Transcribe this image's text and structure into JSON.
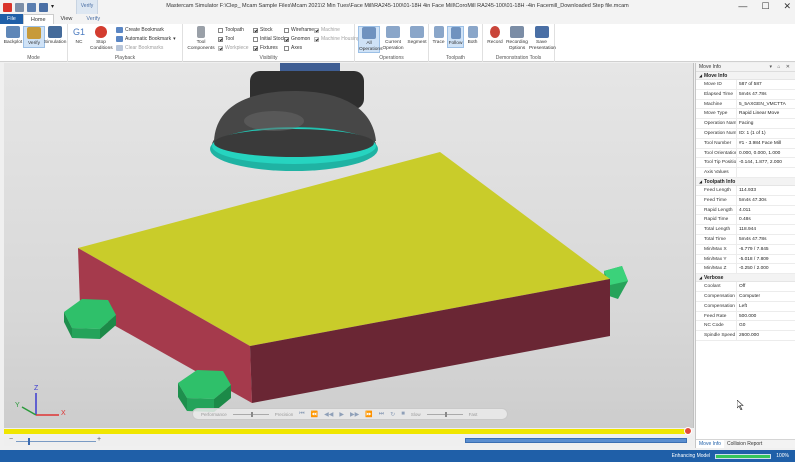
{
  "app": {
    "title": "Mastercam Simulator F:\\Clep_ Mcam Sample Files\\Mcam 2021\\2 Min Tues\\Face Mill\\RA245-100\\01-18H 4in Face Mill\\CoroMill RA245-100\\01-18H -4in Facemill_Downloaded Step file.mcam",
    "context_tab": "Verify",
    "win_min": "—",
    "win_max": "☐",
    "win_close": "✕"
  },
  "tabs": [
    {
      "label": "File"
    },
    {
      "label": "Home"
    },
    {
      "label": "View"
    },
    {
      "label": "Verify"
    }
  ],
  "ribbon": {
    "mode": {
      "label": "Mode",
      "buttons": [
        {
          "label": "Backplot"
        },
        {
          "label": "Verify"
        },
        {
          "label": "Simulation"
        }
      ]
    },
    "playback": {
      "label": "Playback",
      "nc_label": "G1",
      "nc_sub": "NC",
      "stop_label": "Stop",
      "stop_sub": "Conditions",
      "create_bookmark": "Create Bookmark",
      "automatic_bookmark": "Automatic Bookmark",
      "clear_bookmarks": "Clear Bookmarks"
    },
    "visibility": {
      "label": "Visibility",
      "tool_components": "Tool",
      "tool_components_sub": "Components",
      "items": [
        {
          "label": "Toolpath",
          "checked": false,
          "disabled": false
        },
        {
          "label": "Tool",
          "checked": true,
          "disabled": false
        },
        {
          "label": "Workpiece",
          "checked": true,
          "disabled": true
        },
        {
          "label": "Stock",
          "checked": true,
          "disabled": false
        },
        {
          "label": "Initial Stock",
          "checked": false,
          "disabled": false
        },
        {
          "label": "Fixtures",
          "checked": true,
          "disabled": false
        },
        {
          "label": "Wireframe",
          "checked": false,
          "disabled": false
        },
        {
          "label": "Gnomon",
          "checked": true,
          "disabled": false
        },
        {
          "label": "Axes",
          "checked": false,
          "disabled": false
        },
        {
          "label": "Machine",
          "checked": true,
          "disabled": true
        },
        {
          "label": "Machine Housing",
          "checked": true,
          "disabled": true
        }
      ]
    },
    "operations": {
      "label": "Operations",
      "buttons": [
        {
          "label": "All",
          "sub": "Operations"
        },
        {
          "label": "Current",
          "sub": "Operation"
        },
        {
          "label": "Segment",
          "sub": ""
        }
      ]
    },
    "toolpath": {
      "label": "Toolpath",
      "buttons": [
        {
          "label": "Trace"
        },
        {
          "label": "Follow"
        },
        {
          "label": "Both"
        }
      ]
    },
    "demonstration": {
      "label": "Demonstration Tools",
      "buttons": [
        {
          "label": "Record",
          "sub": ""
        },
        {
          "label": "Recording",
          "sub": "Options"
        },
        {
          "label": "Save",
          "sub": "Presentation"
        }
      ]
    }
  },
  "playback_bar": {
    "performance": "Performance",
    "precision": "Precision",
    "slow": "Slow",
    "fast": "Fast",
    "controls": [
      "⏮",
      "⏪",
      "◀◀",
      "▶",
      "▶▶",
      "⏩",
      "⏭",
      "↻",
      "■"
    ]
  },
  "gnomon": {
    "x": "X",
    "y": "Y",
    "z": "Z"
  },
  "zoom": {
    "minus": "−",
    "plus": "+"
  },
  "status": {
    "label": "Enhancing Model",
    "percent": "100%",
    "progress": 1.0
  },
  "panel": {
    "title": "Move Info",
    "ctrls": "▾ ⌂ ✕",
    "sections": [
      {
        "name": "Move Info",
        "rows": [
          {
            "k": "Move ID",
            "v": "587 of 587"
          },
          {
            "k": "Elapsed Time",
            "v": "5m4s 47.78s"
          },
          {
            "k": "Machine",
            "v": "5_5AXGEN_VMCTTA"
          },
          {
            "k": "Move Type",
            "v": "Rapid Linear Move"
          },
          {
            "k": "Operation Name",
            "v": "Facing"
          },
          {
            "k": "Operation Numb",
            "v": "ID: 1 (1 of 1)"
          },
          {
            "k": "Tool Number",
            "v": "#1 - 3.984 Face Mill"
          },
          {
            "k": "Tool Orientation",
            "v": "0.000, 0.000, 1.000"
          },
          {
            "k": "Tool Tip Position",
            "v": "-0.144, 1.877, 2.000"
          },
          {
            "k": "Axis Values",
            "v": ""
          }
        ]
      },
      {
        "name": "Toolpath Info",
        "rows": [
          {
            "k": "Feed Length",
            "v": "114.933"
          },
          {
            "k": "Feed Time",
            "v": "5m4s 47.30s"
          },
          {
            "k": "Rapid Length",
            "v": "4.011"
          },
          {
            "k": "Rapid Time",
            "v": "0.48s"
          },
          {
            "k": "Total Length",
            "v": "118.944"
          },
          {
            "k": "Total Time",
            "v": "5m4s 47.78s"
          },
          {
            "k": "Min/Max X",
            "v": "-6.779 / 7.845"
          },
          {
            "k": "Min/Max Y",
            "v": "-5.018 / 7.809"
          },
          {
            "k": "Min/Max Z",
            "v": "-0.250 / 2.000"
          }
        ]
      },
      {
        "name": "Verbose",
        "rows": [
          {
            "k": "Coolant",
            "v": "Off"
          },
          {
            "k": "Compensation Ty",
            "v": "Computer"
          },
          {
            "k": "Compensation D",
            "v": "Left"
          },
          {
            "k": "Feed Rate",
            "v": "500.000"
          },
          {
            "k": "NC Code",
            "v": "G0"
          },
          {
            "k": "Spindle Speed",
            "v": "2600.000"
          }
        ]
      }
    ],
    "tabs": [
      {
        "label": "Move Info"
      },
      {
        "label": "Collision Report"
      }
    ]
  },
  "colors": {
    "stock_top": "#c9cc2a",
    "stock_side": "#a53a4c",
    "fixture": "#2fc06a",
    "tool_body": "#3a3a3a",
    "tool_ring": "#1fb3a3",
    "accent": "#1f5fa8"
  }
}
